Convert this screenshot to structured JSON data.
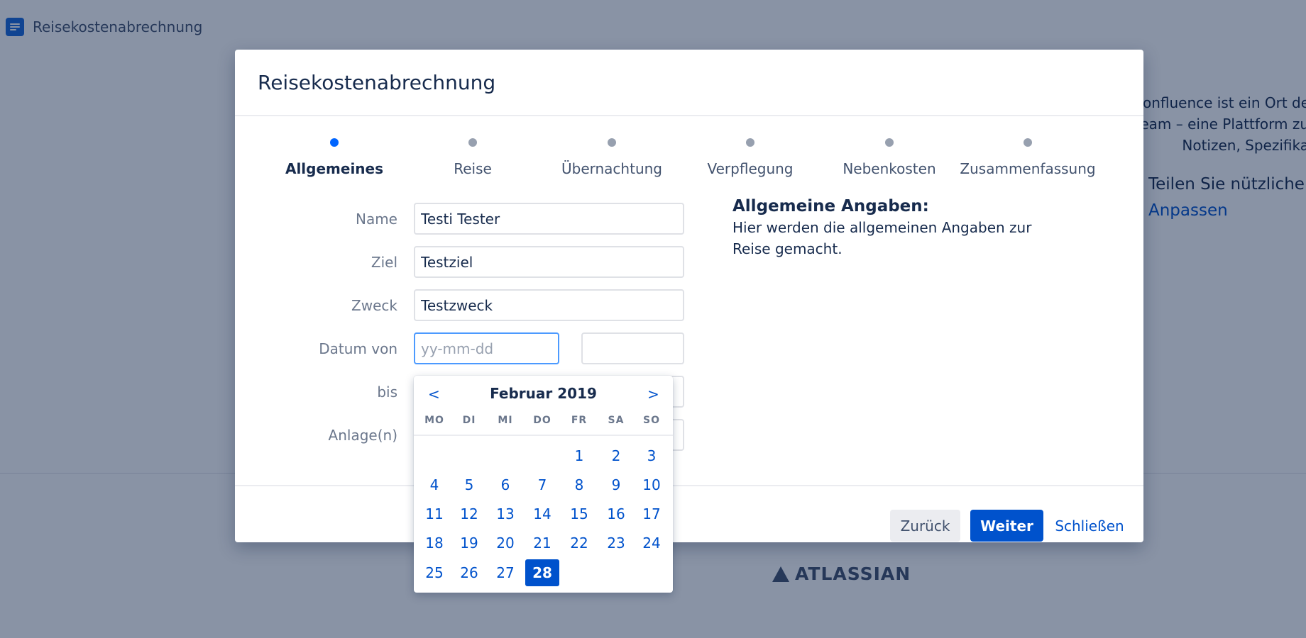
{
  "background": {
    "page_title": "Reisekostenabrechnung",
    "side_text": [
      "Confluence ist ein Ort de",
      "Team – eine Plattform zu",
      "Notizen, Spezifika"
    ],
    "share_text": "Teilen Sie nützliche L",
    "customize_link": "Anpassen",
    "footer_logo": "ATLASSIAN"
  },
  "dialog": {
    "title": "Reisekostenabrechnung",
    "steps": [
      {
        "label": "Allgemeines",
        "active": true
      },
      {
        "label": "Reise",
        "active": false
      },
      {
        "label": "Übernachtung",
        "active": false
      },
      {
        "label": "Verpflegung",
        "active": false
      },
      {
        "label": "Nebenkosten",
        "active": false
      },
      {
        "label": "Zusammenfassung",
        "active": false
      }
    ],
    "form": {
      "name_label": "Name",
      "name_value": "Testi Tester",
      "ziel_label": "Ziel",
      "ziel_value": "Testziel",
      "zweck_label": "Zweck",
      "zweck_value": "Testzweck",
      "datum_von_label": "Datum von",
      "datum_von_placeholder": "yy-mm-dd",
      "bis_label": "bis",
      "anlagen_label": "Anlage(n)"
    },
    "info": {
      "heading": "Allgemeine Angaben:",
      "text": "Hier werden die allgemeinen Angaben zur Reise gemacht."
    },
    "buttons": {
      "back": "Zurück",
      "next": "Weiter",
      "close": "Schließen"
    }
  },
  "datepicker": {
    "prev": "<",
    "next": ">",
    "month_label": "Februar 2019",
    "weekdays": [
      "MO",
      "DI",
      "MI",
      "DO",
      "FR",
      "SA",
      "SO"
    ],
    "first_weekday_index": 4,
    "days_in_month": 28,
    "selected_day": 28
  }
}
